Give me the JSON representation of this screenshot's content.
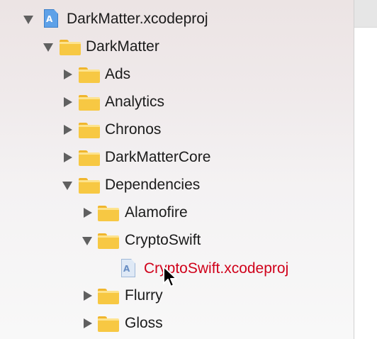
{
  "tree": [
    {
      "label": "DarkMatter.xcodeproj",
      "icon": "xcodeproj-icon",
      "expanded": true
    },
    {
      "label": "DarkMatter",
      "icon": "folder-icon",
      "expanded": true
    },
    {
      "label": "Ads",
      "icon": "folder-icon",
      "expanded": false
    },
    {
      "label": "Analytics",
      "icon": "folder-icon",
      "expanded": false
    },
    {
      "label": "Chronos",
      "icon": "folder-icon",
      "expanded": false
    },
    {
      "label": "DarkMatterCore",
      "icon": "folder-icon",
      "expanded": false
    },
    {
      "label": "Dependencies",
      "icon": "folder-icon",
      "expanded": true
    },
    {
      "label": "Alamofire",
      "icon": "folder-icon",
      "expanded": false
    },
    {
      "label": "CryptoSwift",
      "icon": "folder-icon",
      "expanded": true
    },
    {
      "label": "CryptoSwift.xcodeproj",
      "icon": "xcodeproj-icon",
      "color": "#d0021b"
    },
    {
      "label": "Flurry",
      "icon": "folder-icon",
      "expanded": false
    },
    {
      "label": "Gloss",
      "icon": "folder-icon",
      "expanded": false
    }
  ],
  "colors": {
    "folder": "#f7c843",
    "missing_file": "#d0021b",
    "disclosure": "#606060"
  }
}
